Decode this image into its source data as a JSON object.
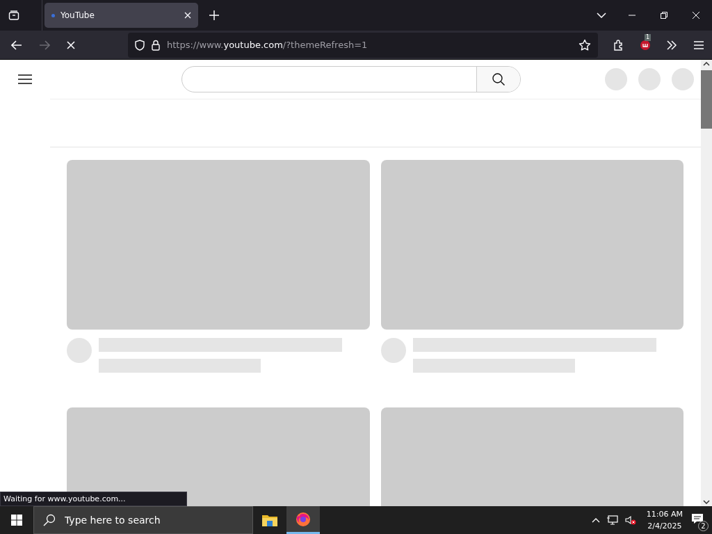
{
  "tabs": [
    {
      "title": "YouTube",
      "selected": true
    }
  ],
  "address_bar": {
    "url_prefix": "https://www.",
    "url_domain": "youtube.com",
    "url_suffix": "/?themeRefresh=1"
  },
  "loading": true,
  "extension_badge": "1",
  "status_text": "Waiting for www.youtube.com...",
  "taskbar": {
    "search_placeholder": "Type here to search",
    "apps": [
      {
        "kind": "explorer",
        "selected": false
      },
      {
        "kind": "firefox",
        "selected": true
      }
    ],
    "time": "11:06 AM",
    "date": "2/4/2025",
    "notification_count": "2"
  }
}
